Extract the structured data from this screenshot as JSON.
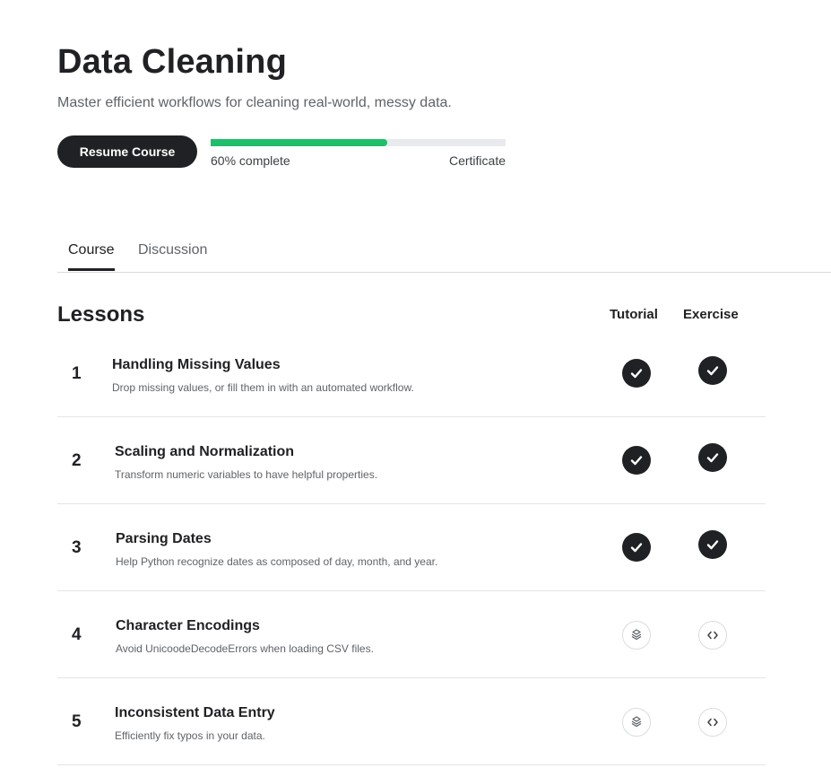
{
  "course": {
    "title": "Data Cleaning",
    "subtitle": "Master efficient workflows for cleaning real-world, messy data.",
    "resume_label": "Resume Course",
    "progress_label": "60% complete",
    "progress_fraction": 0.6,
    "certificate_label": "Certificate"
  },
  "tabs": [
    {
      "label": "Course",
      "active": true
    },
    {
      "label": "Discussion",
      "active": false
    }
  ],
  "lessons_section": {
    "heading": "Lessons",
    "tutorial_header": "Tutorial",
    "exercise_header": "Exercise"
  },
  "lessons": [
    {
      "number": "1",
      "title": "Handling Missing Values",
      "description": "Drop missing values, or fill them in with an automated workflow.",
      "tutorial": "completed",
      "exercise": "completed"
    },
    {
      "number": "2",
      "title": "Scaling and Normalization",
      "description": "Transform numeric variables to have helpful properties.",
      "tutorial": "completed",
      "exercise": "completed"
    },
    {
      "number": "3",
      "title": "Parsing Dates",
      "description": "Help Python recognize dates as composed of day, month, and year.",
      "tutorial": "completed",
      "exercise": "completed"
    },
    {
      "number": "4",
      "title": "Character Encodings",
      "description": "Avoid UnicoodeDecodeErrors when loading CSV files.",
      "tutorial": "not-started",
      "exercise": "not-started"
    },
    {
      "number": "5",
      "title": "Inconsistent Data Entry",
      "description": "Efficiently fix typos in your data.",
      "tutorial": "not-started",
      "exercise": "not-started"
    }
  ],
  "colors": {
    "progress_fill": "#20be6a",
    "primary_dark": "#202124"
  },
  "icons": {
    "completed": "check-circle-icon",
    "tutorial_todo": "book-icon",
    "exercise_todo": "code-icon"
  }
}
